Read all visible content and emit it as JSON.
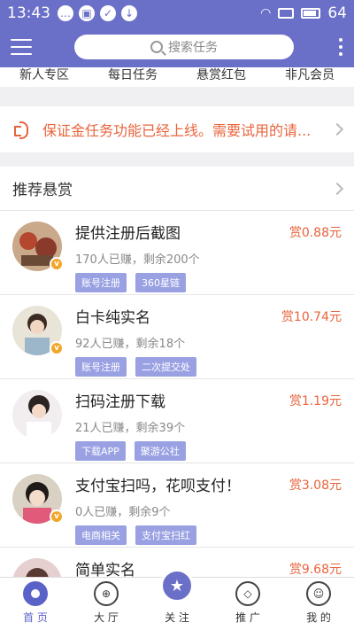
{
  "status_bar": {
    "time": "13:43",
    "battery": "64"
  },
  "header": {
    "search_placeholder": "搜索任务"
  },
  "categories": [
    "新人专区",
    "每日任务",
    "悬赏红包",
    "非凡会员"
  ],
  "notice": {
    "text": "保证金任务功能已经上线。需要试用的请..."
  },
  "recommend": {
    "title": "推荐悬赏"
  },
  "tasks": [
    {
      "title": "提供注册后截图",
      "stats": "170人已赚，剩余200个",
      "tags": [
        "账号注册",
        "360星链"
      ],
      "reward": "赏0.88元"
    },
    {
      "title": "白卡纯实名",
      "stats": "92人已赚，剩余18个",
      "tags": [
        "账号注册",
        "二次提交处"
      ],
      "reward": "赏10.74元"
    },
    {
      "title": "扫码注册下载",
      "stats": "21人已赚，剩余39个",
      "tags": [
        "下载APP",
        "聚游公社"
      ],
      "reward": "赏1.19元"
    },
    {
      "title": "支付宝扫吗，花呗支付！",
      "stats": "0人已赚，剩余9个",
      "tags": [
        "电商相关",
        "支付宝扫红"
      ],
      "reward": "赏3.08元"
    },
    {
      "title": "简单实名",
      "reward": "赏9.68元"
    }
  ],
  "tabbar": {
    "home": "首 页",
    "hall": "大 厅",
    "follow": "关 注",
    "promote": "推 广",
    "mine": "我 的"
  },
  "colors": {
    "primary": "#6a6fc8",
    "accent": "#e8643c",
    "tag_bg": "#9aa1e3"
  }
}
